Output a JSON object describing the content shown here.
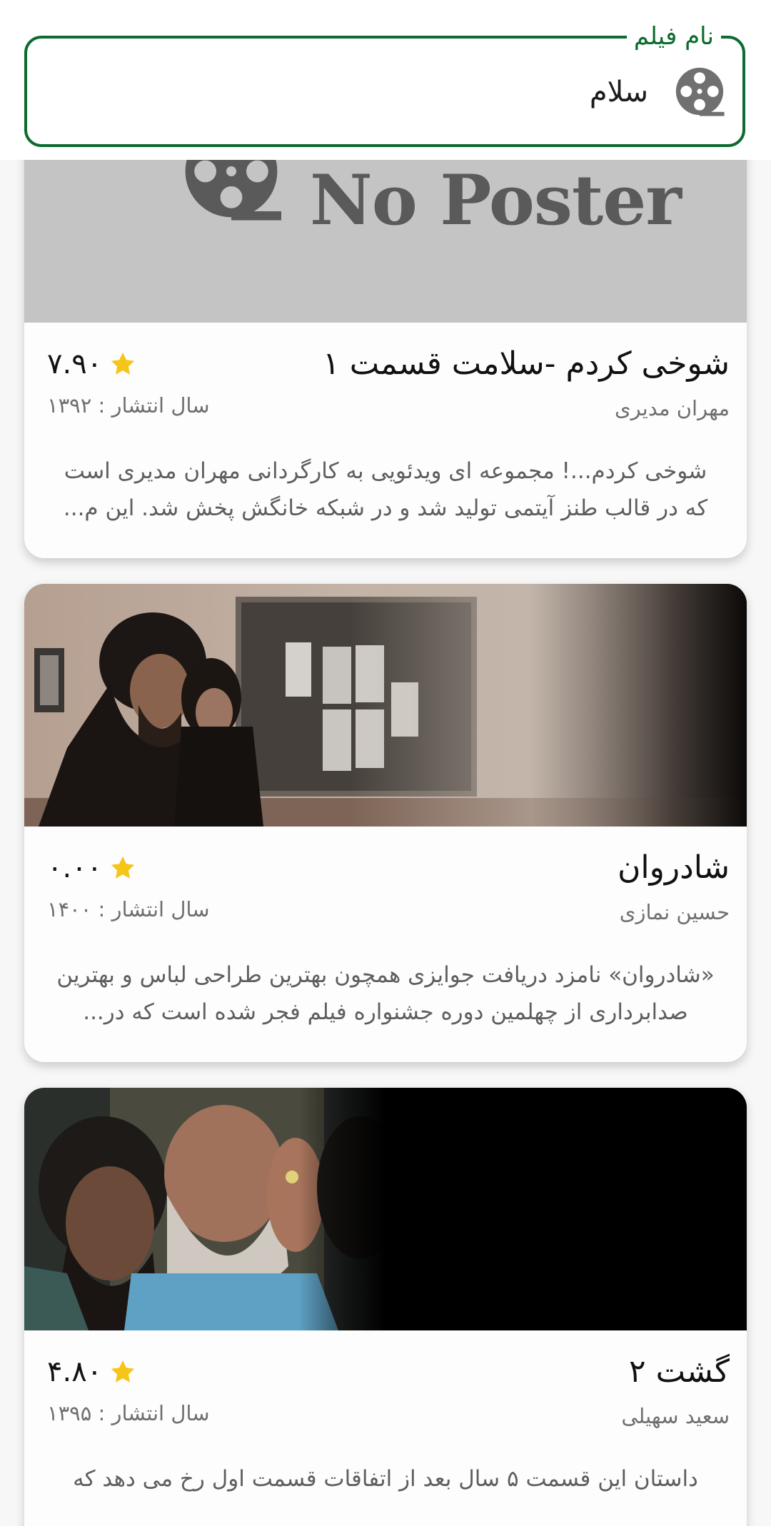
{
  "search": {
    "label": "نام فیلم",
    "value": "سلام"
  },
  "movies": [
    {
      "title": "شوخی کردم -سلامت قسمت ۱",
      "director": "مهران مدیری",
      "rating": "۷.۹۰",
      "year_text": "سال انتشار : ۱۳۹۲",
      "description": "شوخی کردم...! مجموعه ای ویدئویی به کارگردانی مهران مدیری است که در قالب طنز آیتمی تولید شد و در شبکه خانگش پخش شد. این م...",
      "poster_text": "No Poster"
    },
    {
      "title": "شادروان",
      "director": "حسین نمازی",
      "rating": "۰.۰۰",
      "year_text": "سال انتشار : ۱۴۰۰",
      "description": "«شادروان» نامزد دریافت جوایزی همچون بهترین طراحی لباس و بهترین صدابرداری از چهلمین دوره جشنواره فیلم فجر شده است که در..."
    },
    {
      "title": "گشت ۲",
      "director": "سعید سهیلی",
      "rating": "۴.۸۰",
      "year_text": "سال انتشار : ۱۳۹۵",
      "description": "داستان این قسمت ۵ سال بعد از اتفاقات قسمت اول رخ می دهد که"
    }
  ],
  "colors": {
    "accent": "#0c6b2e",
    "star": "#f5c518",
    "placeholder_bg": "#c4c4c4"
  }
}
